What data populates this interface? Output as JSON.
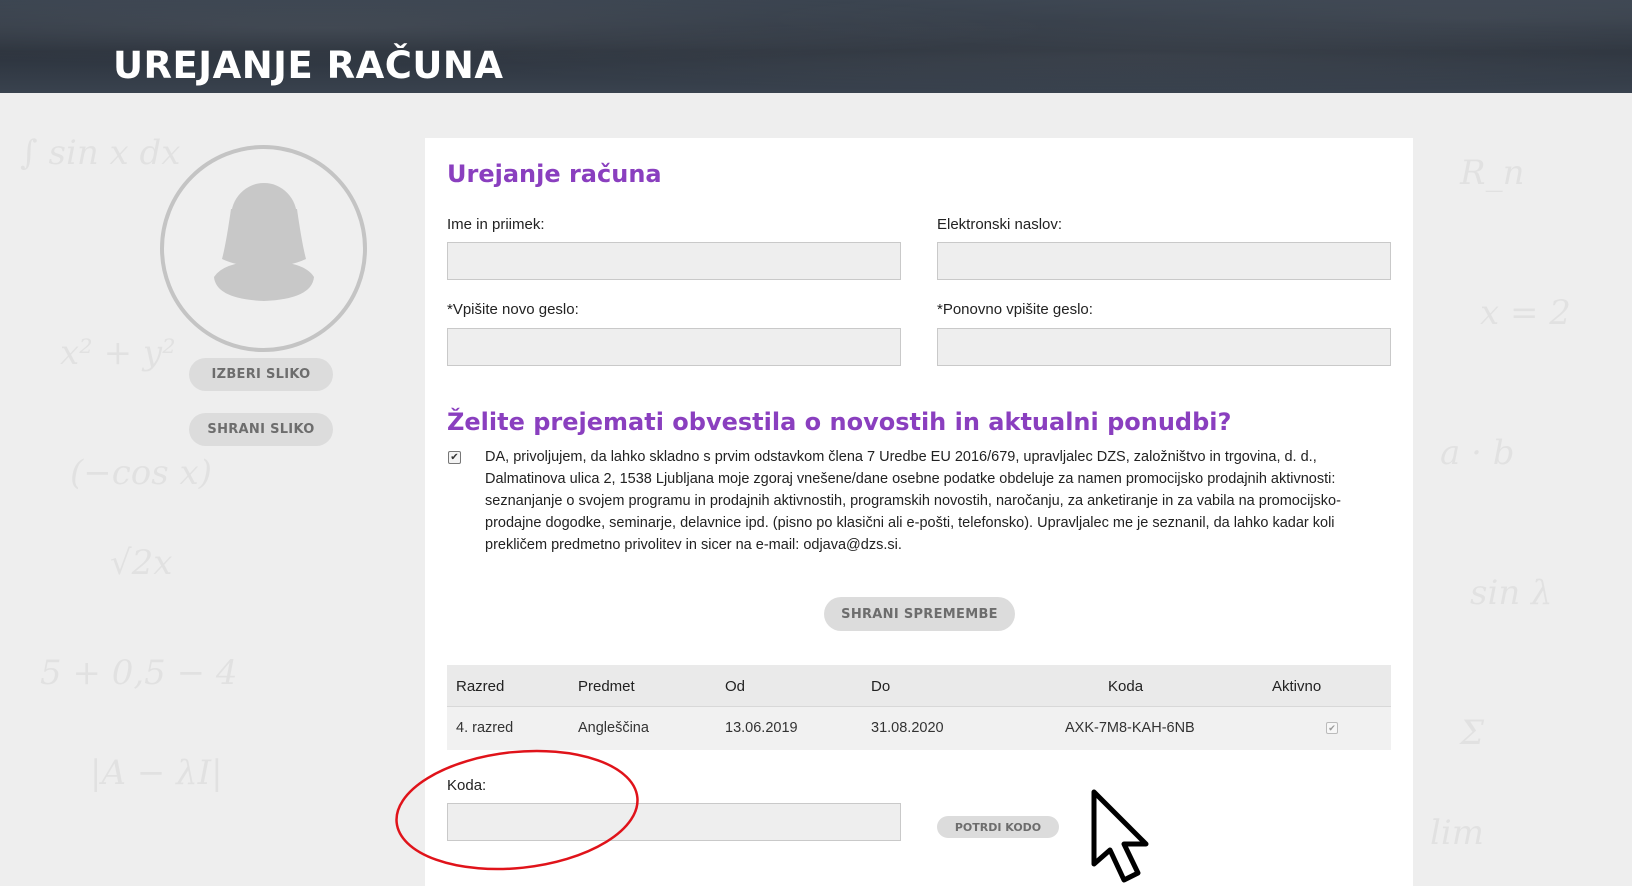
{
  "header": {
    "title": "UREJANJE RAČUNA"
  },
  "sidebar": {
    "choose_image_label": "IZBERI SLIKO",
    "save_image_label": "SHRANI SLIKO"
  },
  "form": {
    "heading": "Urejanje računa",
    "name_label": "Ime in priimek:",
    "email_label": "Elektronski naslov:",
    "new_password_label": "*Vpišite novo geslo:",
    "repeat_password_label": "*Ponovno vpišite geslo:",
    "name_value": "",
    "email_value": "",
    "new_password_value": "",
    "repeat_password_value": ""
  },
  "newsletter": {
    "heading": "Želite prejemati obvestila o novostih in aktualni ponudbi?",
    "checked": true,
    "consent_text": "DA, privoljujem, da lahko skladno s prvim odstavkom člena 7 Uredbe EU 2016/679, upravljalec DZS, založništvo in trgovina, d. d., Dalmatinova ulica 2, 1538 Ljubljana moje zgoraj vnešene/dane osebne podatke obdeluje za namen promocijsko prodajnih aktivnosti: seznanjanje o svojem programu in prodajnih aktivnostih, programskih novostih, naročanju, za anketiranje in za vabila na promocijsko-prodajne dogodke, seminarje, delavnice ipd. (pisno po klasični ali e-pošti, telefonsko). Upravljalec me je seznanil, da lahko kadar koli prekličem predmetno privolitev in sicer na e-mail: odjava@dzs.si.",
    "save_changes_label": "SHRANI SPREMEMBE"
  },
  "table": {
    "headers": [
      "Razred",
      "Predmet",
      "Od",
      "Do",
      "Koda",
      "Aktivno"
    ],
    "rows": [
      {
        "razred": "4. razred",
        "predmet": "Angleščina",
        "od": "13.06.2019",
        "do": "31.08.2020",
        "koda": "AXK-7M8-KAH-6NB",
        "aktivno": true
      }
    ]
  },
  "code": {
    "label": "Koda:",
    "value": "",
    "confirm_label": "POTRDI KODO"
  },
  "colors": {
    "accent": "#8a3fbf",
    "annotation": "#e0131a",
    "button_bg": "#dcdcdc"
  }
}
